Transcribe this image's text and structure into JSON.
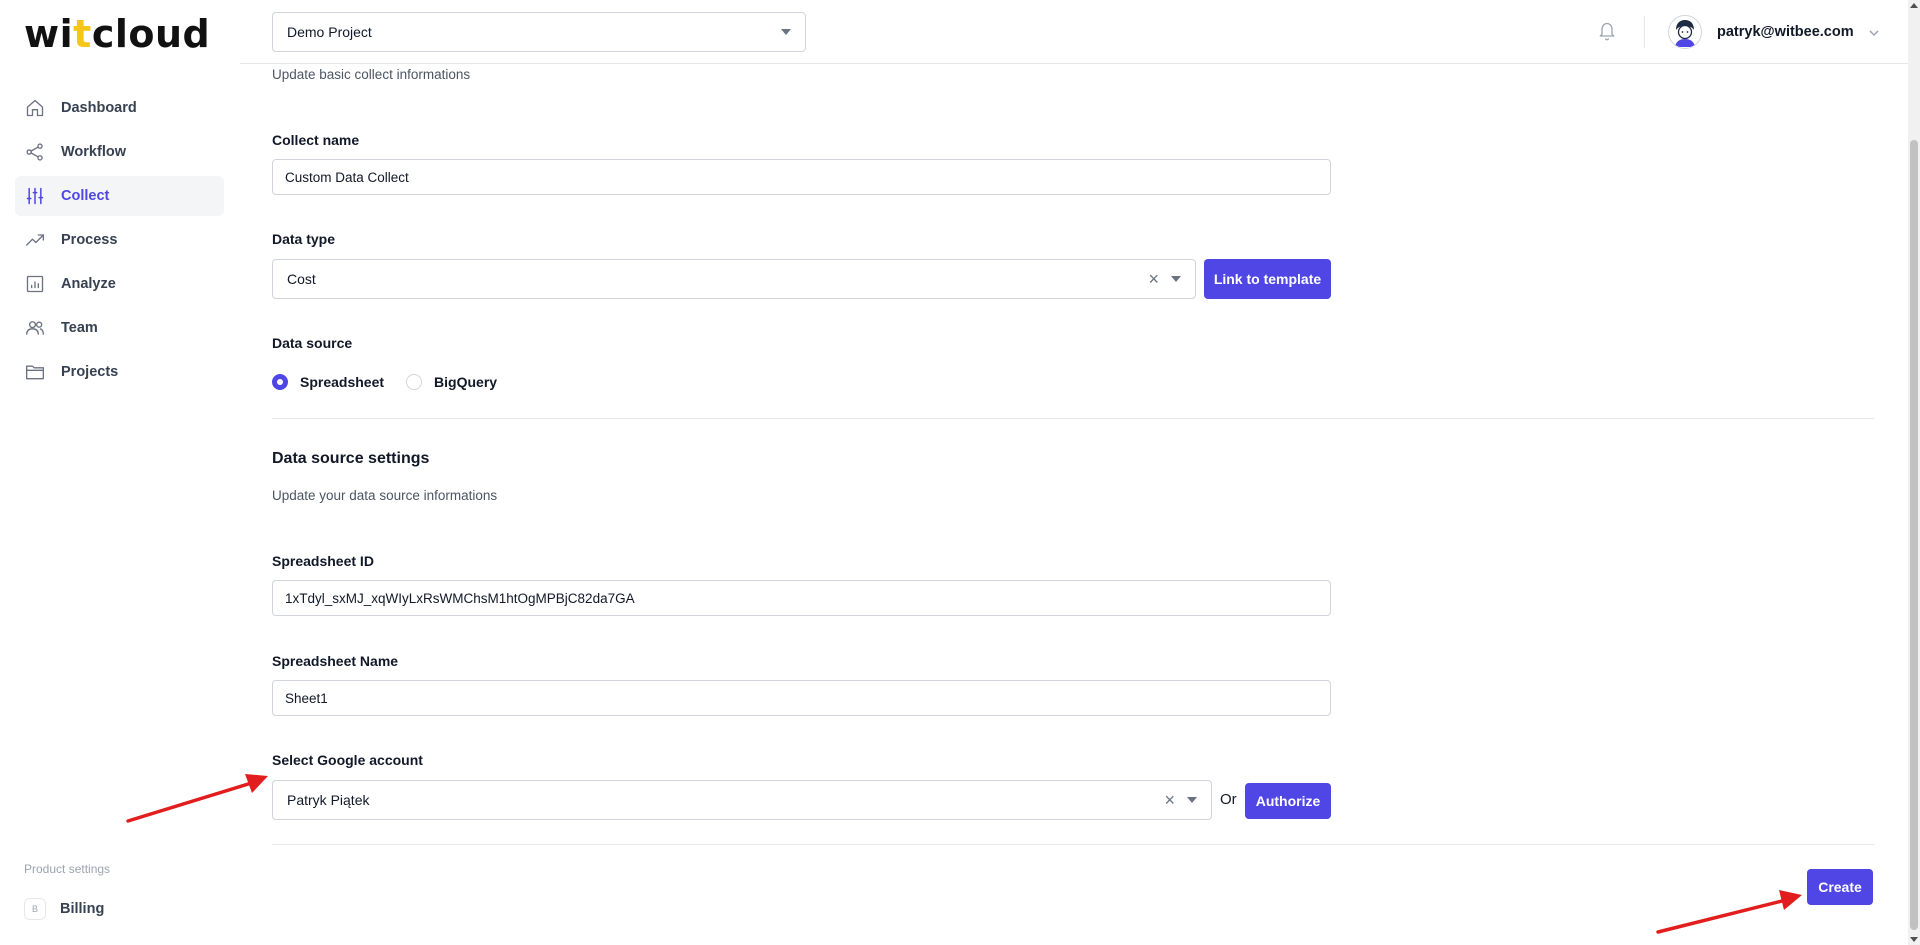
{
  "app": {
    "logo_prefix": "wi",
    "logo_accent": "t",
    "logo_suffix": "cloud",
    "accent_color": "#4f46e5",
    "logo_accent_color": "#f5c518"
  },
  "header": {
    "project_select": {
      "value": "Demo Project"
    },
    "notifications_icon": "bell-icon",
    "user_email": "patryk@witbee.com"
  },
  "sidebar": {
    "items": [
      {
        "label": "Dashboard",
        "icon": "home-icon",
        "active": false
      },
      {
        "label": "Workflow",
        "icon": "share-icon",
        "active": false
      },
      {
        "label": "Collect",
        "icon": "sliders-icon",
        "active": true
      },
      {
        "label": "Process",
        "icon": "trending-icon",
        "active": false
      },
      {
        "label": "Analyze",
        "icon": "chart-icon",
        "active": false
      },
      {
        "label": "Team",
        "icon": "users-icon",
        "active": false
      },
      {
        "label": "Projects",
        "icon": "folder-icon",
        "active": false
      }
    ],
    "product_settings_label": "Product settings",
    "billing": {
      "badge": "B",
      "label": "Billing"
    }
  },
  "form": {
    "basic_subtitle": "Update basic collect informations",
    "collect_name": {
      "label": "Collect name",
      "value": "Custom Data Collect"
    },
    "data_type": {
      "label": "Data type",
      "value": "Cost",
      "link_button": "Link to template"
    },
    "data_source": {
      "label": "Data source",
      "options": [
        {
          "label": "Spreadsheet",
          "checked": true
        },
        {
          "label": "BigQuery",
          "checked": false
        }
      ]
    },
    "source_settings": {
      "title": "Data source settings",
      "subtitle": "Update your data source informations"
    },
    "spreadsheet_id": {
      "label": "Spreadsheet ID",
      "value": "1xTdyl_sxMJ_xqWIyLxRsWMChsM1htOgMPBjC82da7GA"
    },
    "spreadsheet_name": {
      "label": "Spreadsheet Name",
      "value": "Sheet1"
    },
    "google_account": {
      "label": "Select Google account",
      "value": "Patryk Piątek",
      "or_text": "Or",
      "authorize_button": "Authorize"
    },
    "create_button": "Create"
  }
}
